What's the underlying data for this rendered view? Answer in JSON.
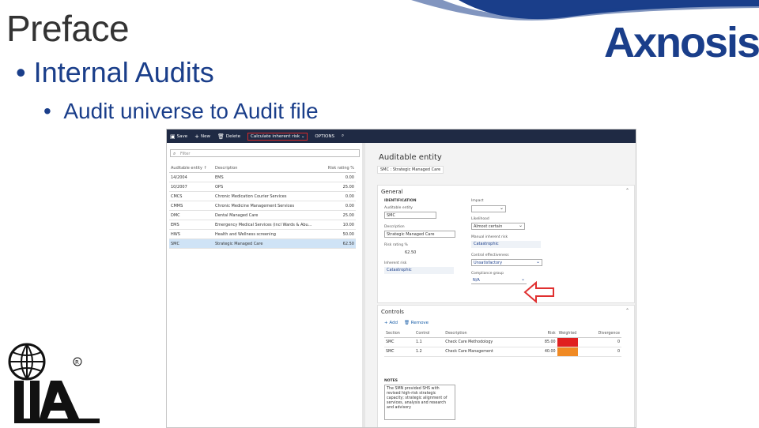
{
  "slide": {
    "title": "Preface",
    "bullet1": "Internal Audits",
    "bullet2": "Audit universe to Audit file",
    "bullet_char": "•"
  },
  "logo": {
    "text": "Axnosis",
    "color": "#1a3e8a"
  },
  "iia_logo": {
    "text": "IIA"
  },
  "app": {
    "toolbar": {
      "save": "Save",
      "new": "New",
      "delete": "Delete",
      "calculate": "Calculate inherent risk",
      "options": "OPTIONS"
    },
    "filter_placeholder": "Filter",
    "list_headers": [
      "Auditable entity ↑",
      "Description",
      "Risk rating %"
    ],
    "list_rows": [
      [
        "14/2004",
        "EMS",
        "0.00"
      ],
      [
        "10/2007",
        "OPS",
        "25.00"
      ],
      [
        "CMCS",
        "Chronic Medication Courier Services",
        "0.00"
      ],
      [
        "CMMS",
        "Chronic Medicine Management Services",
        "0.00"
      ],
      [
        "DMC",
        "Dental Managed Care",
        "25.00"
      ],
      [
        "EMS",
        "Emergency Medical Services (incl Wards & Abu...",
        "10.00"
      ],
      [
        "HWS",
        "Health and Wellness screening",
        "50.00"
      ],
      [
        "SMC",
        "Strategic Managed Care",
        "62.50"
      ]
    ],
    "selected_row": 7,
    "entity": {
      "title": "Auditable entity",
      "subtitle": "SMC : Strategic Managed Care",
      "general": {
        "header": "General",
        "section": "IDENTIFICATION",
        "entity_label": "Auditable entity",
        "entity_value": "SMC",
        "desc_label": "Description",
        "desc_value": "Strategic Managed Care",
        "rating_label": "Risk rating %",
        "rating_value": "62.50",
        "inherent_label": "Inherent risk",
        "inherent_value": "Catastrophic",
        "impact_label": "Impact",
        "impact_value": "",
        "likelihood_label": "Likelihood",
        "likelihood_value": "Almost certain",
        "manual_label": "Manual inherent risk",
        "manual_value": "Catastrophic",
        "control_label": "Control effectiveness",
        "control_value": "Unsatisfactory",
        "compliance_label": "Compliance group",
        "compliance_value": "N/A"
      },
      "controls": {
        "header": "Controls",
        "add": "Add",
        "remove": "Remove",
        "headers": [
          "Section",
          "Control",
          "Description",
          "Risk",
          "Weighted",
          "Divergence"
        ],
        "rows": [
          [
            "SMC",
            "1.1",
            "Check Care Methodology",
            "85.00",
            "",
            "0"
          ],
          [
            "SMC",
            "1.2",
            "Check Care Management",
            "40.00",
            "",
            "0"
          ]
        ],
        "notes_label": "NOTES",
        "notes_text": "The SMN provided SHS with revised high-risk strategic capacity; strategic alignment of services, analysis and research and advisory"
      }
    }
  }
}
